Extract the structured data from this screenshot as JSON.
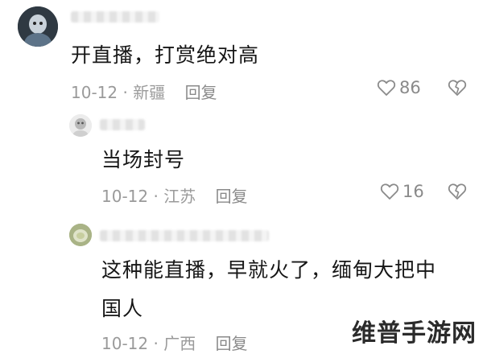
{
  "comments": [
    {
      "text": "开直播，打赏绝对高",
      "date": "10-12",
      "location": "新疆",
      "reply_label": "回复",
      "likes": "86"
    },
    {
      "text": "当场封号",
      "date": "10-12",
      "location": "江苏",
      "reply_label": "回复",
      "likes": "16"
    },
    {
      "text_line1": "这种能直播，早就火了，缅甸大把中",
      "text_line2": "国人",
      "date": "10-12",
      "location": "广西",
      "reply_label": "回复"
    }
  ],
  "meta_separator": "·",
  "watermark": "维普手游网",
  "colors": {
    "text": "#161616",
    "meta": "#9a9a9a",
    "icon": "#8a8a8a"
  }
}
